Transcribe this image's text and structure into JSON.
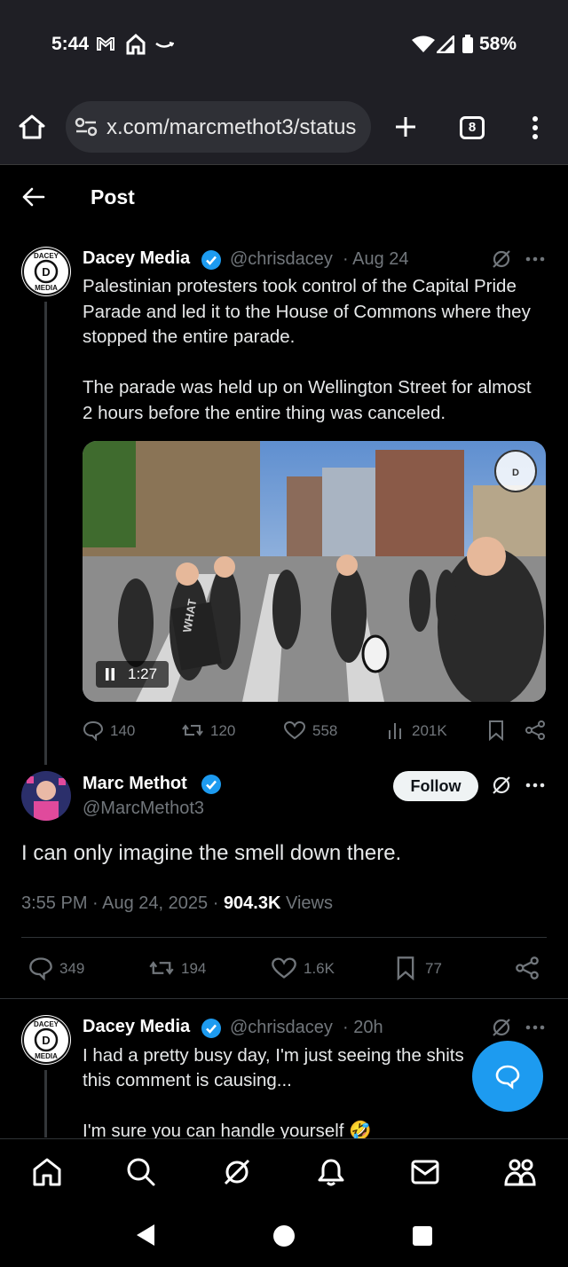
{
  "status_bar": {
    "time": "5:44",
    "battery": "58%"
  },
  "browser": {
    "url": "x.com/marcmethot3/status",
    "tab_count": "8"
  },
  "header": {
    "title": "Post"
  },
  "quoted_tweet": {
    "name": "Dacey Media",
    "handle": "@chrisdacey",
    "date": "· Aug 24",
    "text_p1": "Palestinian protesters took control of the Capital Pride Parade and led it to the House of Commons where they stopped the entire parade.",
    "text_p2": "The parade was held up on Wellington Street for almost 2 hours before the entire thing was canceled.",
    "video_duration": "1:27",
    "video_sign_text": "WHAT",
    "avatar_text_top": "DACEY",
    "avatar_text_bottom": "MEDIA",
    "replies": "140",
    "reposts": "120",
    "likes": "558",
    "views": "201K"
  },
  "main_tweet": {
    "name": "Marc Methot",
    "handle": "@MarcMethot3",
    "follow_label": "Follow",
    "text": "I can only imagine the smell down there.",
    "time": "3:55 PM · Aug 24, 2025 ·",
    "views_count": "904.3K",
    "views_label": "Views",
    "replies": "349",
    "reposts": "194",
    "likes": "1.6K",
    "bookmarks": "77"
  },
  "reply_tweet": {
    "name": "Dacey Media",
    "handle": "@chrisdacey",
    "date": "· 20h",
    "line1": "I had a pretty busy day, I'm just seeing the shits",
    "line2": "this comment is causing...",
    "line3": "I'm sure you can handle yourself 🤣"
  },
  "colors": {
    "verified": "#1d9bf0",
    "background": "#000000",
    "muted": "#71767b"
  }
}
